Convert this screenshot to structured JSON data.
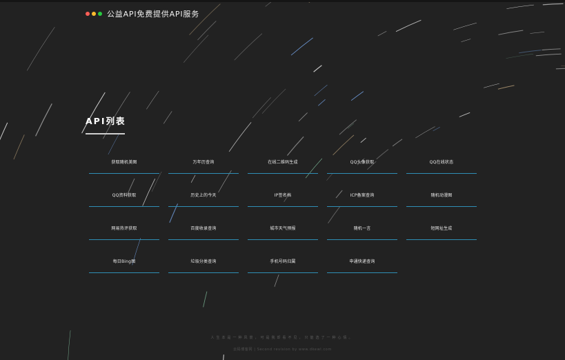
{
  "header": {
    "title": "公益API免费提供API服务",
    "dot_colors": [
      "#ff5f57",
      "#febc2e",
      "#28c840"
    ]
  },
  "section": {
    "title": "API列表"
  },
  "api_items": [
    {
      "label": "获取随机美图"
    },
    {
      "label": "万年历查询"
    },
    {
      "label": "在线二维码生成"
    },
    {
      "label": "QQ头像获取"
    },
    {
      "label": "QQ在线状态"
    },
    {
      "label": "QQ资料获取"
    },
    {
      "label": "历史上的今天"
    },
    {
      "label": "IP签名档"
    },
    {
      "label": "ICP备案查询"
    },
    {
      "label": "随机动漫图"
    },
    {
      "label": "网易热评获取"
    },
    {
      "label": "百度收录查询"
    },
    {
      "label": "城市天气预报"
    },
    {
      "label": "随机一言"
    },
    {
      "label": "短网址生成"
    },
    {
      "label": "每日Bing图"
    },
    {
      "label": "垃圾分类查询"
    },
    {
      "label": "手机号码归属"
    },
    {
      "label": "申通快递查询"
    }
  ],
  "footer": {
    "quote": "人生本是一种风景，可是我却看不见，只能选了一种心情。",
    "credit": "云码博客网 | Second revision by www.dkewl.com"
  },
  "colors": {
    "background": "#222222",
    "accent_underline": "#2f8fb6"
  }
}
